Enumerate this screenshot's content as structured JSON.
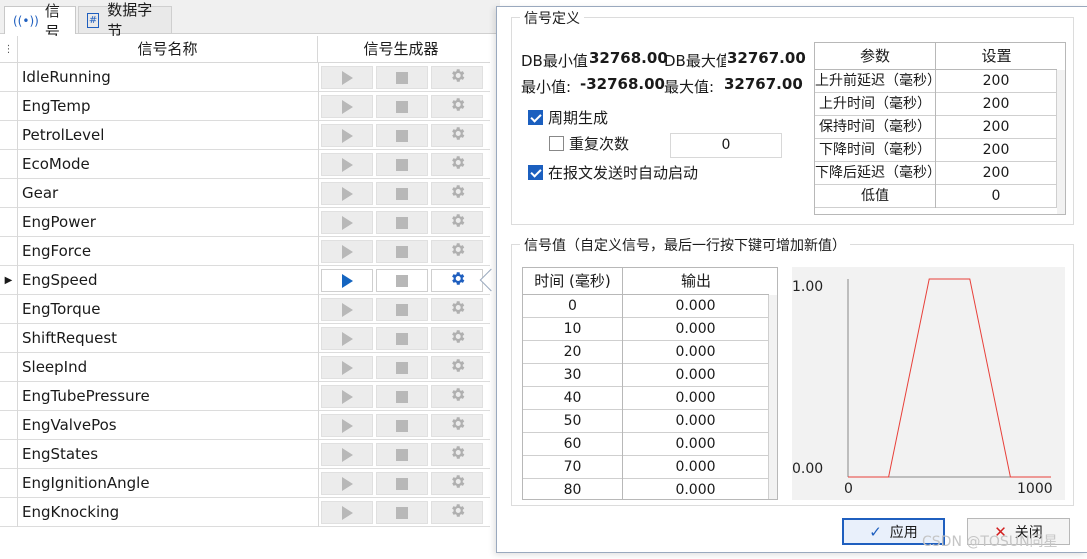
{
  "tabs": [
    {
      "label": "信号",
      "icon": "signal-icon"
    },
    {
      "label": "数据字节",
      "icon": "hash-icon"
    }
  ],
  "grid": {
    "headers": {
      "name": "信号名称",
      "generator": "信号生成器"
    },
    "signals": [
      "IdleRunning",
      "EngTemp",
      "PetrolLevel",
      "EcoMode",
      "Gear",
      "EngPower",
      "EngForce",
      "EngSpeed",
      "EngTorque",
      "ShiftRequest",
      "SleepInd",
      "EngTubePressure",
      "EngValvePos",
      "EngStates",
      "EngIgnitionAngle",
      "EngKnocking"
    ],
    "selected_signal": "EngSpeed"
  },
  "definition": {
    "title": "信号定义",
    "db_min_label": "DB最小值",
    "db_min_value": "32768.00",
    "db_max_label": "DB最大值",
    "db_max_value": "32767.00",
    "min_label": "最小值:",
    "min_value": "-32768.00",
    "max_label": "最大值:",
    "max_value": "32767.00",
    "periodic_label": "周期生成",
    "periodic_checked": true,
    "repeat_label": "重复次数",
    "repeat_checked": false,
    "repeat_value": "0",
    "autostart_label": "在报文发送时自动启动",
    "autostart_checked": true,
    "params_headers": {
      "param": "参数",
      "setting": "设置"
    },
    "params": [
      {
        "name": "上升前延迟（毫秒）",
        "value": "200"
      },
      {
        "name": "上升时间（毫秒）",
        "value": "200"
      },
      {
        "name": "保持时间（毫秒）",
        "value": "200"
      },
      {
        "name": "下降时间（毫秒）",
        "value": "200"
      },
      {
        "name": "下降后延迟（毫秒）",
        "value": "200"
      },
      {
        "name": "低值",
        "value": "0"
      }
    ]
  },
  "values_group": {
    "title": "信号值（自定义信号，最后一行按下键可增加新值）",
    "headers": {
      "time": "时间 (毫秒)",
      "output": "输出"
    },
    "rows": [
      {
        "time": "0",
        "output": "0.000"
      },
      {
        "time": "10",
        "output": "0.000"
      },
      {
        "time": "20",
        "output": "0.000"
      },
      {
        "time": "30",
        "output": "0.000"
      },
      {
        "time": "40",
        "output": "0.000"
      },
      {
        "time": "50",
        "output": "0.000"
      },
      {
        "time": "60",
        "output": "0.000"
      },
      {
        "time": "70",
        "output": "0.000"
      },
      {
        "time": "80",
        "output": "0.000"
      }
    ]
  },
  "chart_data": {
    "type": "line",
    "x": [
      0,
      200,
      400,
      600,
      800,
      1000
    ],
    "series": [
      {
        "values": [
          0,
          0,
          1,
          1,
          0,
          0
        ],
        "color": "#e8403a"
      }
    ],
    "xtick_labels": [
      "0",
      "1000"
    ],
    "ytick_labels": [
      "0.00",
      "1.00"
    ],
    "xlim": [
      0,
      1000
    ],
    "ylim": [
      0,
      1
    ]
  },
  "buttons": {
    "apply": "应用",
    "close": "关闭"
  },
  "watermark": "CSDN @TOSUN同星",
  "colors": {
    "accent": "#1f5fbf",
    "play_active": "#1565c0",
    "line": "#e8403a",
    "close_icon": "#d21f1f"
  }
}
